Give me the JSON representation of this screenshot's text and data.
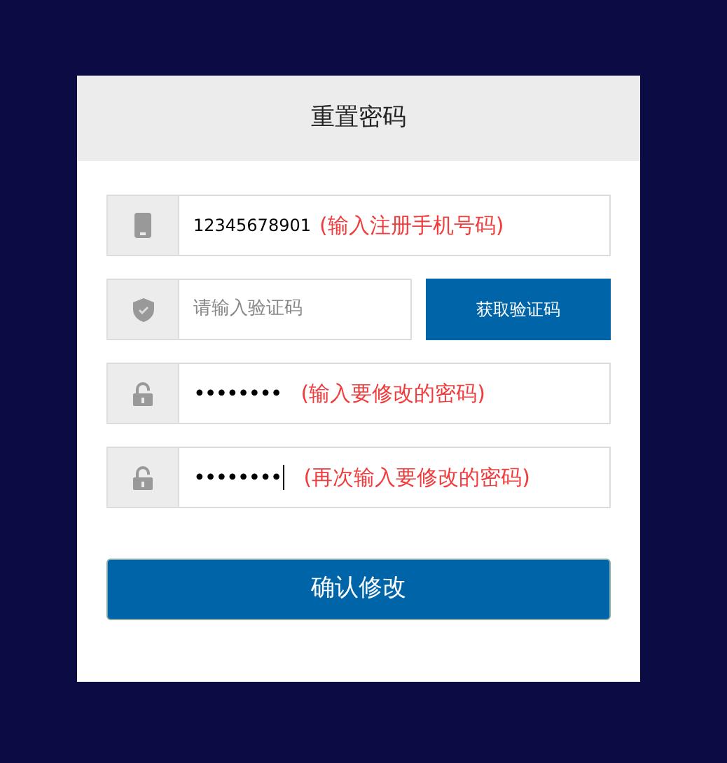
{
  "title": "重置密码",
  "fields": [
    {
      "kind": "phone",
      "value": "12345678901",
      "note": "(输入注册手机号码)",
      "focused": false
    },
    {
      "kind": "code",
      "placeholder": "请输入验证码",
      "focused": false,
      "button": "获取验证码"
    },
    {
      "kind": "password",
      "value": "••••••••",
      "note": "(输入要修改的密码)",
      "focused": false
    },
    {
      "kind": "password",
      "value": "••••••••",
      "note": "(再次输入要修改的密码)",
      "focused": true
    }
  ],
  "submit": "确认修改"
}
